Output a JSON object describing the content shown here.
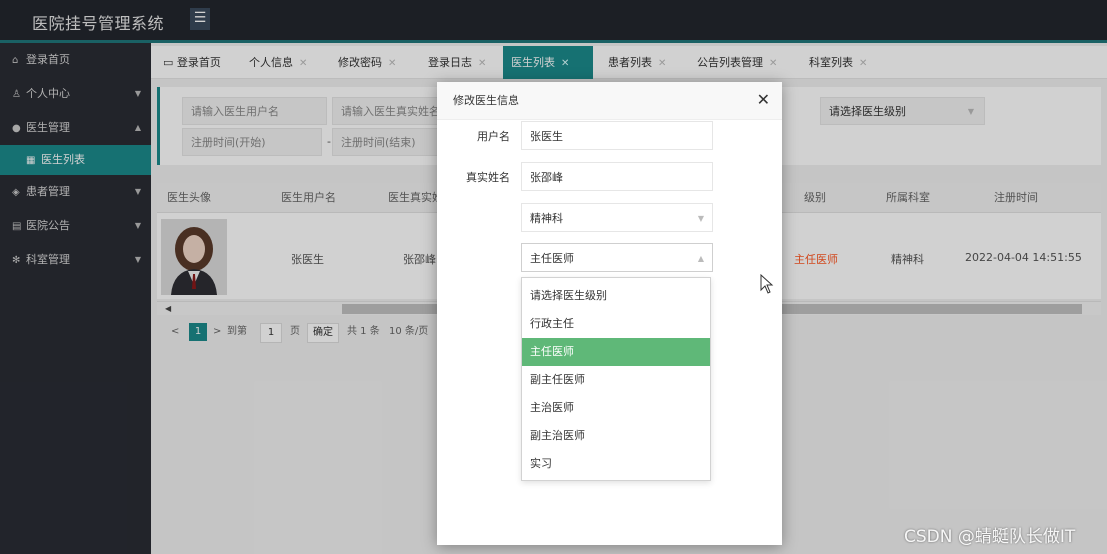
{
  "header": {
    "title": "医院挂号管理系统",
    "menu_icon": "hamburger-icon"
  },
  "sidebar": {
    "items": [
      {
        "label": "登录首页",
        "icon": "home-icon"
      },
      {
        "label": "个人中心",
        "icon": "user-icon"
      },
      {
        "label": "医生管理",
        "icon": "gear-icon"
      },
      {
        "label": "医生列表",
        "icon": "calendar-icon"
      },
      {
        "label": "患者管理",
        "icon": "layers-icon"
      },
      {
        "label": "医院公告",
        "icon": "notice-icon"
      },
      {
        "label": "科室管理",
        "icon": "snowflake-icon"
      }
    ]
  },
  "tabs": [
    {
      "label": "登录首页",
      "icon": "monitor-icon"
    },
    {
      "label": "个人信息"
    },
    {
      "label": "修改密码"
    },
    {
      "label": "登录日志"
    },
    {
      "label": "医生列表"
    },
    {
      "label": "患者列表"
    },
    {
      "label": "公告列表管理"
    },
    {
      "label": "科室列表"
    }
  ],
  "search": {
    "username_placeholder": "请输入医生用户名",
    "realname_placeholder": "请输入医生真实姓名",
    "level_placeholder": "请选择医生级别",
    "start_placeholder": "注册时间(开始)",
    "end_placeholder": "注册时间(结束)",
    "range_separator": "-"
  },
  "table": {
    "columns": [
      "医生头像",
      "医生用户名",
      "医生真实姓名",
      "级别",
      "所属科室",
      "注册时间"
    ],
    "rows": [
      {
        "username": "张医生",
        "realname": "张邵峰",
        "level": "主任医师",
        "department": "精神科",
        "registered": "2022-04-04 14:51:55"
      }
    ]
  },
  "pagination": {
    "current": "1",
    "goto_label": "到第",
    "page_input": "1",
    "page_suffix": "页",
    "confirm": "确定",
    "total": "共 1 条",
    "page_size": "10 条/页"
  },
  "modal": {
    "title": "修改医生信息",
    "fields": {
      "username_label": "用户名",
      "username_value": "张医生",
      "realname_label": "真实姓名",
      "realname_value": "张邵峰",
      "department_value": "精神科",
      "level_value": "主任医师"
    },
    "level_options": [
      "请选择医生级别",
      "行政主任",
      "主任医师",
      "副主任医师",
      "主治医师",
      "副主治医师",
      "实习"
    ],
    "selected_index": 2
  },
  "watermark": "CSDN @蜻蜓队长做IT",
  "colors": {
    "accent": "#1b8a8c",
    "selected": "#5fb878",
    "level_text": "#ff5722",
    "sidebar_bg": "#2a2c34"
  }
}
